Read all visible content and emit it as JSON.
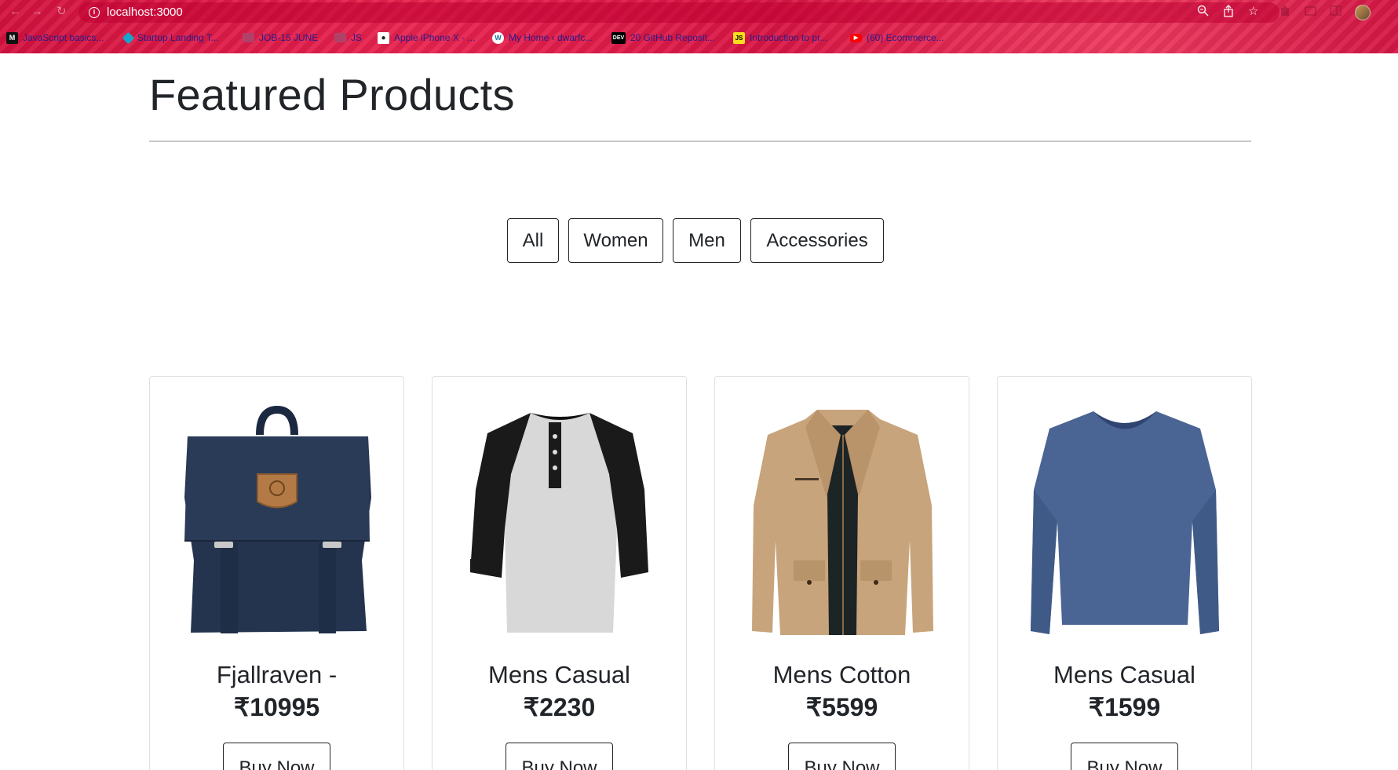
{
  "browser": {
    "url": "localhost:3000",
    "bookmarks": [
      {
        "label": "JavaScript basics...",
        "icon": "medium-logo-icon"
      },
      {
        "label": "Startup Landing T...",
        "icon": "startup-logo-icon"
      },
      {
        "label": "JOB-15 JUNE",
        "icon": "folder-icon"
      },
      {
        "label": "JS",
        "icon": "folder-icon"
      },
      {
        "label": "Apple iPhone X - ...",
        "icon": "apple-site-icon"
      },
      {
        "label": "My Home ‹ dwarfc...",
        "icon": "wordpress-icon"
      },
      {
        "label": "20 GitHub Reposit...",
        "icon": "dev-logo-icon"
      },
      {
        "label": "Introduction to pr...",
        "icon": "js-logo-icon"
      },
      {
        "label": "(60) Ecommerce...",
        "icon": "youtube-icon"
      }
    ],
    "dev_badge": "DEV",
    "js_badge": "JS"
  },
  "page": {
    "title": "Featured Products"
  },
  "filters": [
    "All",
    "Women",
    "Men",
    "Accessories"
  ],
  "products": [
    {
      "title": "Fjallraven -",
      "price": "₹10995",
      "button": "Buy Now",
      "image": "backpack-image"
    },
    {
      "title": "Mens Casual",
      "price": "₹2230",
      "button": "Buy Now",
      "image": "raglan-tshirt-image"
    },
    {
      "title": "Mens Cotton",
      "price": "₹5599",
      "button": "Buy Now",
      "image": "jacket-image"
    },
    {
      "title": "Mens Casual",
      "price": "₹1599",
      "button": "Buy Now",
      "image": "blue-longsleeve-image"
    }
  ],
  "colors": {
    "chrome_accent": "#e0204b",
    "text": "#212529"
  }
}
